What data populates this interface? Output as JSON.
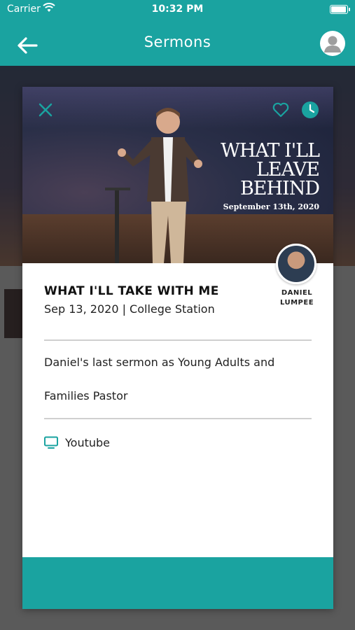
{
  "status_bar": {
    "carrier": "Carrier",
    "time": "10:32 PM",
    "battery_level": 1.0
  },
  "header": {
    "title": "Sermons"
  },
  "sermon": {
    "series_art": {
      "line1": "WHAT I'LL",
      "line2": "LEAVE",
      "line3": "BEHIND",
      "date": "September 13th, 2020"
    },
    "title": "WHAT I'LL TAKE WITH ME",
    "meta": "Sep 13, 2020 | College Station",
    "speaker": {
      "first": "DANIEL",
      "last": "LUMPEE"
    },
    "description": "Daniel's last sermon as Young Adults and Families Pastor",
    "media_link": "Youtube"
  },
  "colors": {
    "accent": "#1aa3a0"
  },
  "icons": [
    "back-arrow-icon",
    "profile-icon",
    "close-icon",
    "heart-icon",
    "clock-icon",
    "tv-icon",
    "wifi-icon",
    "battery-icon"
  ]
}
